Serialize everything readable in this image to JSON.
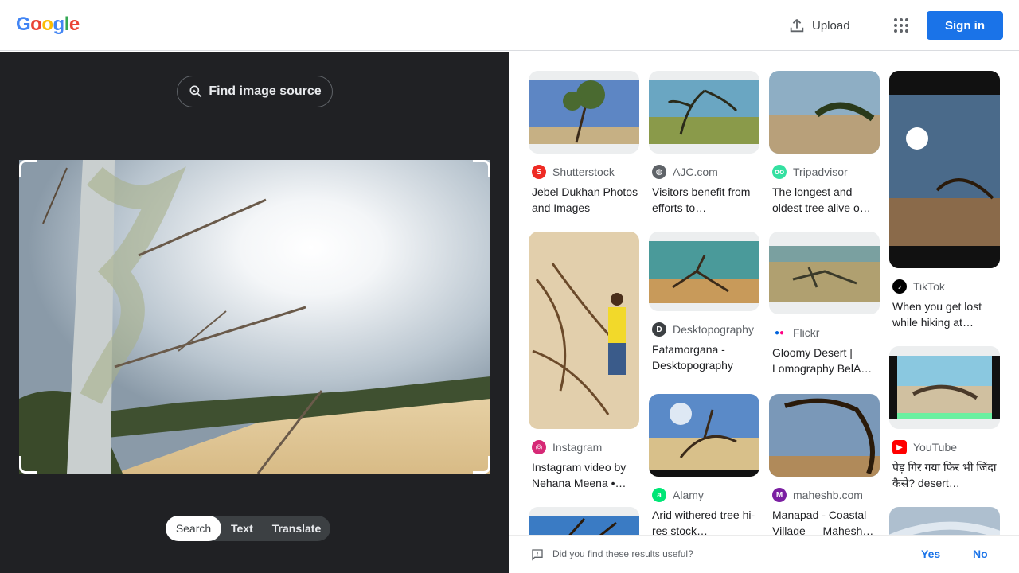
{
  "header": {
    "logo": [
      "G",
      "o",
      "o",
      "g",
      "l",
      "e"
    ],
    "upload_label": "Upload",
    "signin_label": "Sign in"
  },
  "left_panel": {
    "find_source_label": "Find image source",
    "tabs": [
      {
        "label": "Search",
        "active": true
      },
      {
        "label": "Text",
        "active": false
      },
      {
        "label": "Translate",
        "active": false
      }
    ]
  },
  "results": [
    {
      "source": "Shutterstock",
      "title": "Jebel Dukhan Photos and Images",
      "favicon": "shutterstock-icon",
      "fav_color": "#ee2b24"
    },
    {
      "source": "AJC.com",
      "title": "Visitors benefit from efforts to…",
      "favicon": "globe-icon",
      "fav_color": "#5f6368"
    },
    {
      "source": "Tripadvisor",
      "title": "The longest and oldest tree alive o…",
      "favicon": "tripadvisor-icon",
      "fav_color": "#34e0a1"
    },
    {
      "source": "TikTok",
      "title": "When you get lost while hiking at…",
      "favicon": "tiktok-icon",
      "fav_color": "#000000"
    },
    {
      "source": "Instagram",
      "title": "Instagram video by Nehana Meena •…",
      "favicon": "instagram-icon",
      "fav_color": "#d62976"
    },
    {
      "source": "Desktopography",
      "title": "Fatamorgana - Desktopography",
      "favicon": "desktopography-icon",
      "fav_color": "#3c4043"
    },
    {
      "source": "Flickr",
      "title": "Gloomy Desert | Lomography BelA…",
      "favicon": "flickr-icon",
      "fav_color": "#0063dc"
    },
    {
      "source": "YouTube",
      "title": "पेड़ गिर गया फिर भी जिंदा कैसे? desert…",
      "favicon": "youtube-icon",
      "fav_color": "#ff0000"
    },
    {
      "source": "Alamy",
      "title": "Arid withered tree hi-res stock…",
      "favicon": "alamy-icon",
      "fav_color": "#00e676"
    },
    {
      "source": "maheshb.com",
      "title": "Manapad - Coastal Village — Mahesh…",
      "favicon": "maheshb-icon",
      "fav_color": "#7b1fa2"
    }
  ],
  "feedback": {
    "question": "Did you find these results useful?",
    "yes": "Yes",
    "no": "No"
  },
  "colors": {
    "accent": "#1a73e8",
    "panel_bg": "#202124"
  }
}
